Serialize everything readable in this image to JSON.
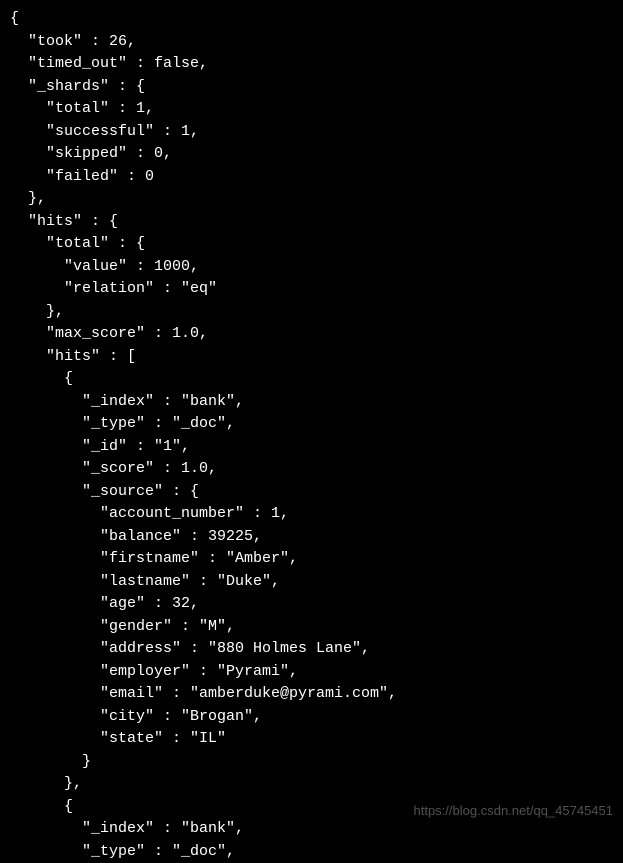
{
  "lines": [
    "{",
    "  \"took\" : 26,",
    "  \"timed_out\" : false,",
    "  \"_shards\" : {",
    "    \"total\" : 1,",
    "    \"successful\" : 1,",
    "    \"skipped\" : 0,",
    "    \"failed\" : 0",
    "  },",
    "  \"hits\" : {",
    "    \"total\" : {",
    "      \"value\" : 1000,",
    "      \"relation\" : \"eq\"",
    "    },",
    "    \"max_score\" : 1.0,",
    "    \"hits\" : [",
    "      {",
    "        \"_index\" : \"bank\",",
    "        \"_type\" : \"_doc\",",
    "        \"_id\" : \"1\",",
    "        \"_score\" : 1.0,",
    "        \"_source\" : {",
    "          \"account_number\" : 1,",
    "          \"balance\" : 39225,",
    "          \"firstname\" : \"Amber\",",
    "          \"lastname\" : \"Duke\",",
    "          \"age\" : 32,",
    "          \"gender\" : \"M\",",
    "          \"address\" : \"880 Holmes Lane\",",
    "          \"employer\" : \"Pyrami\",",
    "          \"email\" : \"amberduke@pyrami.com\",",
    "          \"city\" : \"Brogan\",",
    "          \"state\" : \"IL\"",
    "        }",
    "      },",
    "      {",
    "        \"_index\" : \"bank\",",
    "        \"_type\" : \"_doc\","
  ],
  "watermark": "https://blog.csdn.net/qq_45745451"
}
